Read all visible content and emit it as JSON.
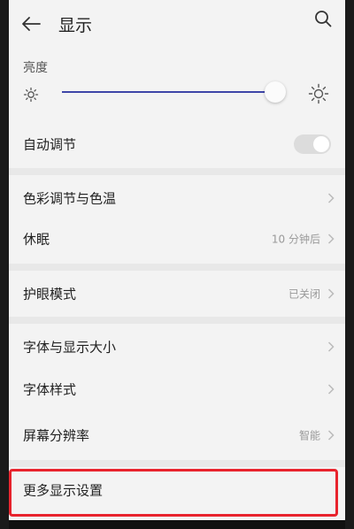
{
  "header": {
    "title": "显示",
    "back_icon": "arrow-left-icon",
    "search_icon": "search-icon"
  },
  "brightness": {
    "label": "亮度",
    "level_fraction": 0.92,
    "track_color": "#3e46a8"
  },
  "auto_adjust": {
    "label": "自动调节",
    "enabled": false
  },
  "items": [
    {
      "label": "色彩调节与色温",
      "value": ""
    },
    {
      "label": "休眠",
      "value": "10 分钟后"
    },
    {
      "label": "护眼模式",
      "value": "已关闭"
    },
    {
      "label": "字体与显示大小",
      "value": ""
    },
    {
      "label": "字体样式",
      "value": ""
    },
    {
      "label": "屏幕分辨率",
      "value": "智能"
    },
    {
      "label": "更多显示设置",
      "value": ""
    }
  ],
  "colors": {
    "highlight": "#e8232d",
    "background": "#f3f3f3"
  }
}
